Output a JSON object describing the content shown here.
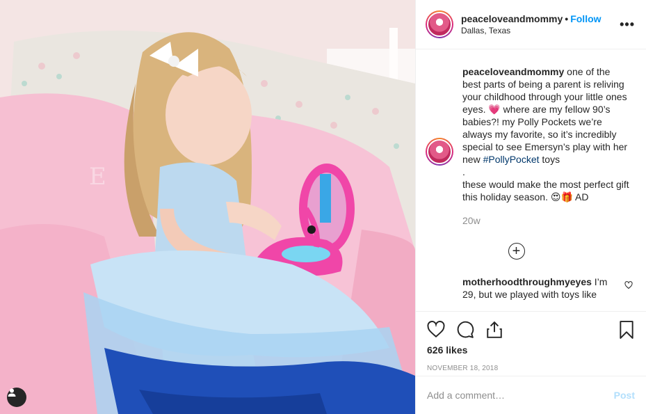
{
  "header": {
    "username": "peaceloveandmommy",
    "separator": "•",
    "follow_label": "Follow",
    "location": "Dallas, Texas",
    "more_label": "•••"
  },
  "caption": {
    "username": "peaceloveandmommy",
    "text_part1": " one of the best parts of being a parent is reliving your childhood through your little ones eyes. 💗 where are my fellow 90’s babies?! my Polly Pockets we’re always my favorite, so it’s incredibly special to see Emersyn’s play with her new ",
    "hashtag": "#PollyPocket",
    "text_part2": " toys",
    "text_part3": ".",
    "text_part4": "these would make the most perfect gift this holiday season. 😍🎁 AD",
    "time_ago": "20w"
  },
  "load_more_label": "+",
  "comments": [
    {
      "username": "motherhoodthroughmyeyes",
      "text": " I’m 29, but we played with toys like"
    }
  ],
  "likes": "626 likes",
  "date": "NOVEMBER 18, 2018",
  "add_comment": {
    "placeholder": "Add a comment…",
    "post_label": "Post"
  },
  "icons": [
    "heart-icon",
    "comment-icon",
    "share-icon",
    "bookmark-icon",
    "user-tag-icon",
    "plus-circle-icon"
  ],
  "colors": {
    "accent": "#0095f6",
    "post_disabled": "#b2dffc",
    "muted": "#8e8e8e"
  }
}
